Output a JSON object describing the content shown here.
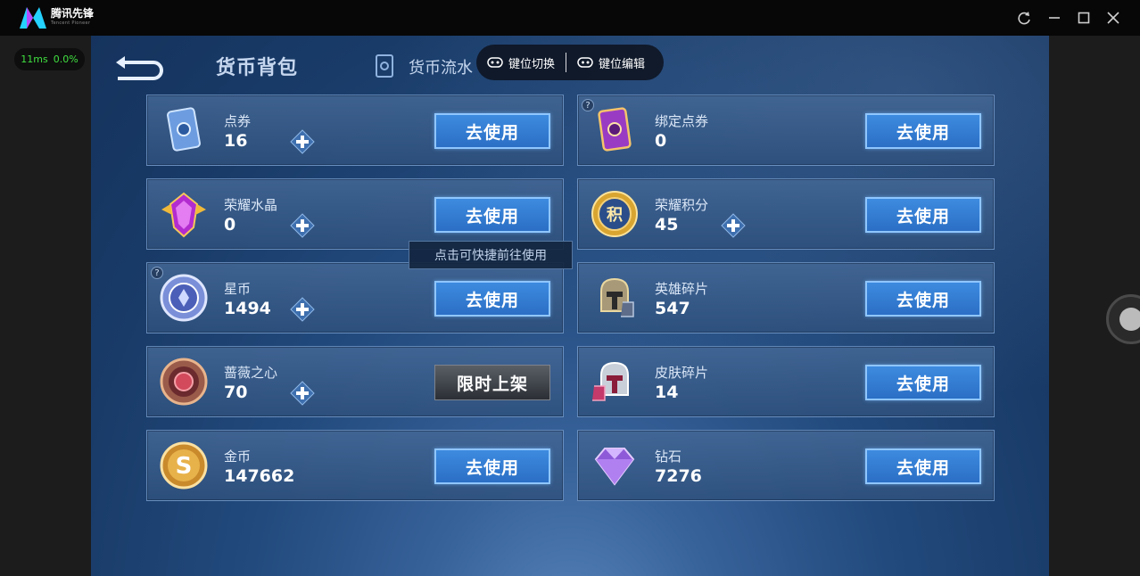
{
  "window": {
    "app_name": "腾讯先锋",
    "app_sub": "Tencent Pioneer",
    "controls": [
      "refresh-icon",
      "minimize-icon",
      "maximize-icon",
      "close-icon"
    ]
  },
  "status": {
    "latency": "11ms",
    "loss": "0.0%"
  },
  "game": {
    "header_title": "货币背包",
    "flow_label": "货币流水",
    "key_switch_label": "键位切换",
    "key_edit_label": "键位编辑",
    "tooltip": "点击可快捷前往使用",
    "use_label": "去使用",
    "limited_label": "限时上架",
    "items": [
      {
        "name": "点券",
        "count": "16"
      },
      {
        "name": "绑定点券",
        "count": "0"
      },
      {
        "name": "荣耀水晶",
        "count": "0"
      },
      {
        "name": "荣耀积分",
        "count": "45"
      },
      {
        "name": "星币",
        "count": "1494"
      },
      {
        "name": "英雄碎片",
        "count": "547"
      },
      {
        "name": "蔷薇之心",
        "count": "70"
      },
      {
        "name": "皮肤碎片",
        "count": "14"
      },
      {
        "name": "金币",
        "count": "147662"
      },
      {
        "name": "钻石",
        "count": "7276"
      }
    ],
    "help_mark": "?"
  },
  "colors": {
    "accent_blue": "#2b6fc5",
    "ping_green": "#40e040",
    "background_deep": "#15335d"
  }
}
